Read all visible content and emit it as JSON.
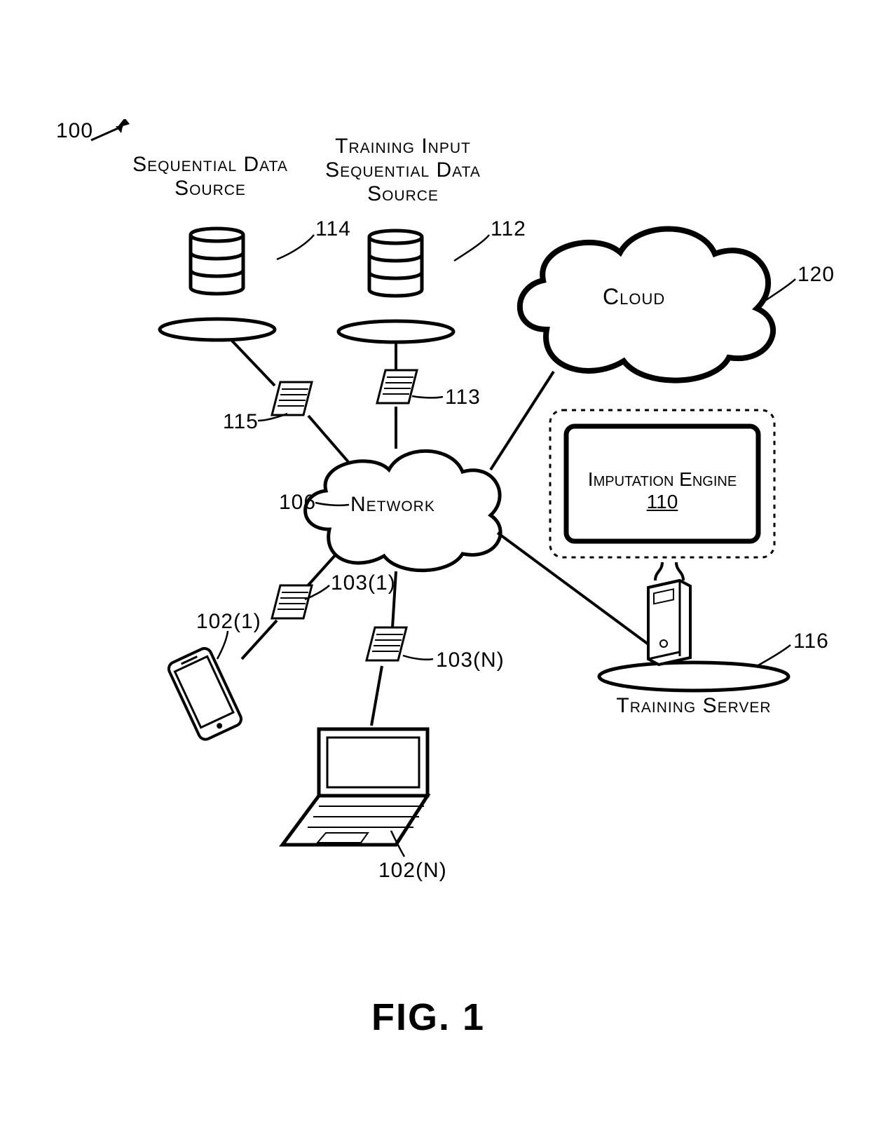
{
  "figure_label": "FIG. 1",
  "ref_100": "100",
  "labels": {
    "seq_data_source": "Sequential Data\nSource",
    "training_input": "Training Input\nSequential Data\nSource",
    "cloud": "Cloud",
    "network": "Network",
    "training_server": "Training Server",
    "imputation_engine": "Imputation Engine",
    "imputation_engine_ref": "110"
  },
  "refs": {
    "r114": "114",
    "r112": "112",
    "r120": "120",
    "r115": "115",
    "r113": "113",
    "r106": "106",
    "r103_1": "103(1)",
    "r102_1": "102(1)",
    "r103_n": "103(N)",
    "r102_n": "102(N)",
    "r116": "116"
  }
}
